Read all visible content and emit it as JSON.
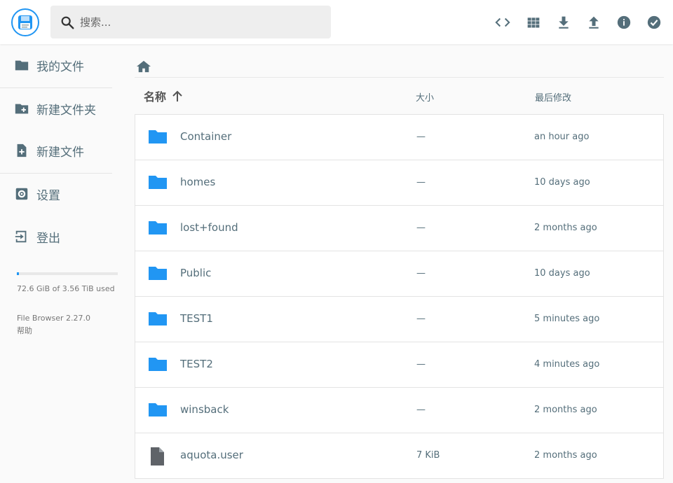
{
  "header": {
    "search_placeholder": "搜索...",
    "icons": [
      "logo-icon",
      "search-icon",
      "code-icon",
      "grid-view-icon",
      "download-icon",
      "upload-icon",
      "info-icon",
      "check-circle-icon"
    ]
  },
  "sidebar": {
    "items": [
      {
        "label": "我的文件",
        "icon": "folder-icon"
      },
      {
        "label": "新建文件夹",
        "icon": "new-folder-icon"
      },
      {
        "label": "新建文件",
        "icon": "new-file-icon"
      },
      {
        "label": "设置",
        "icon": "settings-icon"
      },
      {
        "label": "登出",
        "icon": "logout-icon"
      }
    ],
    "quota_text": "72.6 GiB of 3.56 TiB used",
    "quota_fraction": 0.02,
    "version": "File Browser 2.27.0",
    "help": "帮助"
  },
  "listing": {
    "columns": {
      "name": "名称",
      "size": "大小",
      "modified": "最后修改"
    },
    "rows": [
      {
        "name": "Container",
        "size": "—",
        "modified": "an hour ago",
        "type": "folder"
      },
      {
        "name": "homes",
        "size": "—",
        "modified": "10 days ago",
        "type": "folder"
      },
      {
        "name": "lost+found",
        "size": "—",
        "modified": "2 months ago",
        "type": "folder"
      },
      {
        "name": "Public",
        "size": "—",
        "modified": "10 days ago",
        "type": "folder"
      },
      {
        "name": "TEST1",
        "size": "—",
        "modified": "5 minutes ago",
        "type": "folder"
      },
      {
        "name": "TEST2",
        "size": "—",
        "modified": "4 minutes ago",
        "type": "folder"
      },
      {
        "name": "winsback",
        "size": "—",
        "modified": "2 months ago",
        "type": "folder"
      },
      {
        "name": "aquota.user",
        "size": "7 KiB",
        "modified": "2 months ago",
        "type": "file"
      }
    ]
  },
  "colors": {
    "accent": "#2196f3",
    "text": "#546e7a",
    "folder": "#2196f3",
    "file": "#5f6368"
  }
}
